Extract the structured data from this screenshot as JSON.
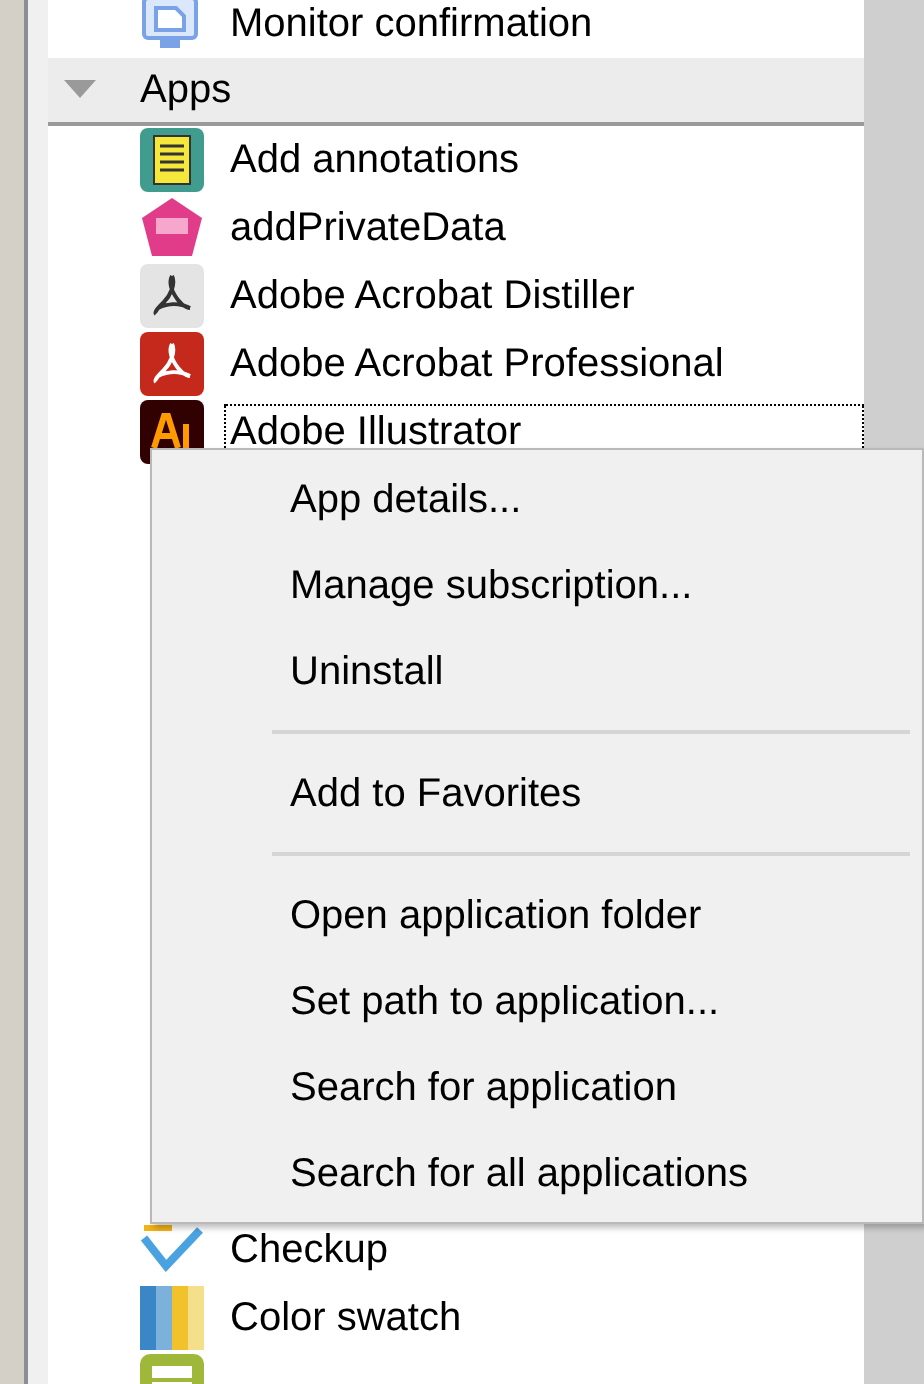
{
  "list": {
    "items": [
      {
        "kind": "item",
        "label": "Monitor confirmation",
        "focused": false
      },
      {
        "kind": "group",
        "label": "Apps",
        "expanded": true
      },
      {
        "kind": "item",
        "label": "Add annotations",
        "focused": false
      },
      {
        "kind": "item",
        "label": "addPrivateData",
        "focused": false
      },
      {
        "kind": "item",
        "label": "Adobe Acrobat Distiller",
        "focused": false
      },
      {
        "kind": "item",
        "label": "Adobe Acrobat Professional",
        "focused": false
      },
      {
        "kind": "item",
        "label": "Adobe Illustrator",
        "focused": true
      },
      {
        "kind": "hidden"
      },
      {
        "kind": "item",
        "label": "Checkup",
        "focused": false
      },
      {
        "kind": "item",
        "label": "Color swatch",
        "focused": false
      },
      {
        "kind": "cut"
      }
    ]
  },
  "context_menu": {
    "items": [
      {
        "kind": "item",
        "label": "App details..."
      },
      {
        "kind": "item",
        "label": "Manage subscription..."
      },
      {
        "kind": "item",
        "label": "Uninstall"
      },
      {
        "kind": "separator"
      },
      {
        "kind": "item",
        "label": "Add to Favorites"
      },
      {
        "kind": "separator"
      },
      {
        "kind": "item",
        "label": "Open application folder"
      },
      {
        "kind": "item",
        "label": "Set path to application..."
      },
      {
        "kind": "item",
        "label": "Search for application"
      },
      {
        "kind": "item",
        "label": "Search for all applications"
      }
    ]
  }
}
